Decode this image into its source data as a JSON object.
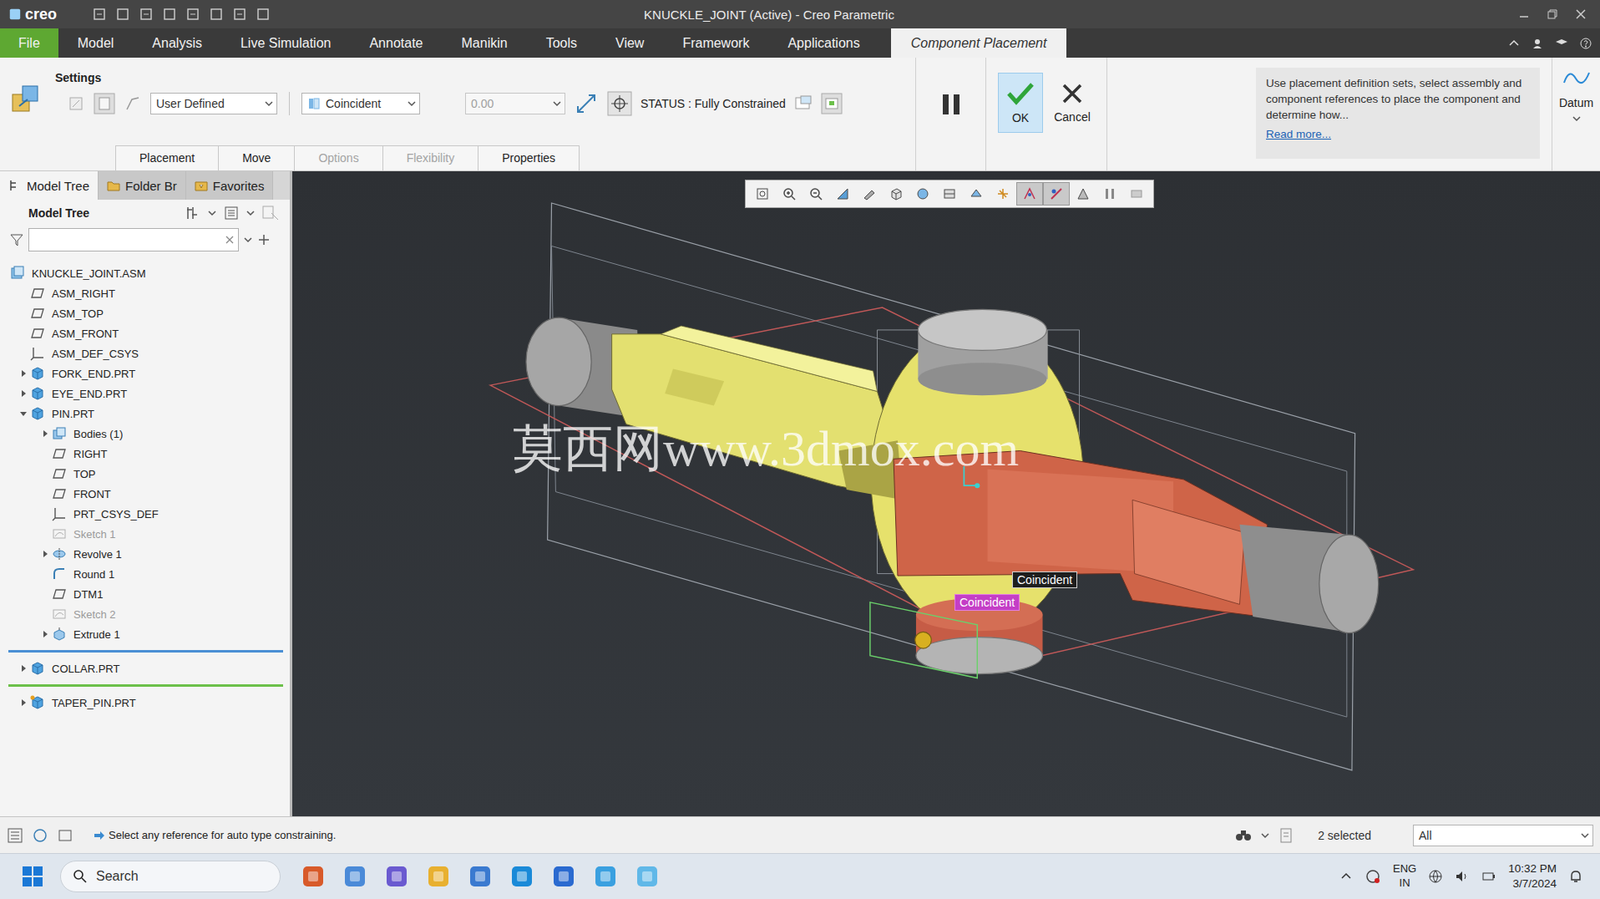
{
  "window": {
    "title": "KNUCKLE_JOINT (Active) - Creo Parametric",
    "logo": "creo"
  },
  "menu": [
    {
      "label": "File",
      "kind": "file",
      "selected": false
    },
    {
      "label": "Model",
      "kind": "tab",
      "selected": false
    },
    {
      "label": "Analysis",
      "kind": "tab",
      "selected": false
    },
    {
      "label": "Live Simulation",
      "kind": "tab",
      "selected": false
    },
    {
      "label": "Annotate",
      "kind": "tab",
      "selected": false
    },
    {
      "label": "Manikin",
      "kind": "tab",
      "selected": false
    },
    {
      "label": "Tools",
      "kind": "tab",
      "selected": false
    },
    {
      "label": "View",
      "kind": "tab",
      "selected": false
    },
    {
      "label": "Framework",
      "kind": "tab",
      "selected": false
    },
    {
      "label": "Applications",
      "kind": "tab",
      "selected": false
    },
    {
      "label": "Component Placement",
      "kind": "context",
      "selected": true
    }
  ],
  "ribbon": {
    "group_label": "Settings",
    "set_type": "User Defined",
    "constraint_type": "Coincident",
    "offset": {
      "value": "0.00",
      "disabled": true
    },
    "status": "STATUS : Fully Constrained",
    "ok": "OK",
    "cancel": "Cancel",
    "help": "Use placement definition sets, select assembly and component references to place the component and determine how...",
    "read_more": "Read more...",
    "datum": "Datum",
    "sub_tabs": [
      {
        "label": "Placement",
        "disabled": false,
        "selected": false
      },
      {
        "label": "Move",
        "disabled": false,
        "selected": false
      },
      {
        "label": "Options",
        "disabled": true,
        "selected": false
      },
      {
        "label": "Flexibility",
        "disabled": true,
        "selected": false
      },
      {
        "label": "Properties",
        "disabled": false,
        "selected": false
      }
    ]
  },
  "model_tree": {
    "tabs": [
      {
        "label": "Model Tree",
        "selected": true
      },
      {
        "label": "Folder Br",
        "selected": false
      },
      {
        "label": "Favorites",
        "selected": false
      }
    ],
    "title": "Model Tree",
    "items": [
      {
        "label": "KNUCKLE_JOINT.ASM",
        "level": 0,
        "kind": "assembly",
        "expander": "none",
        "greyed": false,
        "placing": false
      },
      {
        "label": "ASM_RIGHT",
        "level": 1,
        "kind": "plane",
        "expander": "none",
        "greyed": false,
        "placing": false
      },
      {
        "label": "ASM_TOP",
        "level": 1,
        "kind": "plane",
        "expander": "none",
        "greyed": false,
        "placing": false
      },
      {
        "label": "ASM_FRONT",
        "level": 1,
        "kind": "plane",
        "expander": "none",
        "greyed": false,
        "placing": false
      },
      {
        "label": "ASM_DEF_CSYS",
        "level": 1,
        "kind": "csys",
        "expander": "none",
        "greyed": false,
        "placing": false
      },
      {
        "label": "FORK_END.PRT",
        "level": 1,
        "kind": "part",
        "expander": "collapsed",
        "greyed": false,
        "placing": false
      },
      {
        "label": "EYE_END.PRT",
        "level": 1,
        "kind": "part",
        "expander": "collapsed",
        "greyed": false,
        "placing": false
      },
      {
        "label": "PIN.PRT",
        "level": 1,
        "kind": "part",
        "expander": "expanded",
        "greyed": false,
        "placing": false
      },
      {
        "label": "Bodies (1)",
        "level": 2,
        "kind": "bodies",
        "expander": "collapsed",
        "greyed": false,
        "placing": false
      },
      {
        "label": "RIGHT",
        "level": 2,
        "kind": "plane",
        "expander": "none",
        "greyed": false,
        "placing": false
      },
      {
        "label": "TOP",
        "level": 2,
        "kind": "plane",
        "expander": "none",
        "greyed": false,
        "placing": false
      },
      {
        "label": "FRONT",
        "level": 2,
        "kind": "plane",
        "expander": "none",
        "greyed": false,
        "placing": false
      },
      {
        "label": "PRT_CSYS_DEF",
        "level": 2,
        "kind": "csys",
        "expander": "none",
        "greyed": false,
        "placing": false
      },
      {
        "label": "Sketch 1",
        "level": 2,
        "kind": "sketch",
        "expander": "none",
        "greyed": true,
        "placing": false
      },
      {
        "label": "Revolve 1",
        "level": 2,
        "kind": "revolve",
        "expander": "collapsed",
        "greyed": false,
        "placing": false
      },
      {
        "label": "Round 1",
        "level": 2,
        "kind": "round",
        "expander": "none",
        "greyed": false,
        "placing": false
      },
      {
        "label": "DTM1",
        "level": 2,
        "kind": "plane",
        "expander": "none",
        "greyed": false,
        "placing": false
      },
      {
        "label": "Sketch 2",
        "level": 2,
        "kind": "sketch",
        "expander": "none",
        "greyed": true,
        "placing": false
      },
      {
        "label": "Extrude 1",
        "level": 2,
        "kind": "extrude",
        "expander": "collapsed",
        "greyed": false,
        "placing": false
      },
      {
        "label": "",
        "level": 0,
        "kind": "divider",
        "expander": "none",
        "greyed": false,
        "placing": false,
        "color": "#4a8fd4"
      },
      {
        "label": "COLLAR.PRT",
        "level": 1,
        "kind": "part",
        "expander": "collapsed",
        "greyed": false,
        "placing": false
      },
      {
        "label": "",
        "level": 0,
        "kind": "divider",
        "expander": "none",
        "greyed": false,
        "placing": false,
        "color": "#6cc04a"
      },
      {
        "label": "TAPER_PIN.PRT",
        "level": 1,
        "kind": "part",
        "expander": "collapsed",
        "greyed": false,
        "placing": true
      }
    ]
  },
  "viewport": {
    "watermark": "莫西网www.3dmox.com",
    "labels": [
      {
        "text": "Coincident",
        "selected": false
      },
      {
        "text": "Coincident",
        "selected": true
      }
    ],
    "toolbar": [
      {
        "selected": false
      },
      {
        "selected": false
      },
      {
        "selected": false
      },
      {
        "selected": false
      },
      {
        "selected": false
      },
      {
        "selected": false
      },
      {
        "selected": false
      },
      {
        "selected": false
      },
      {
        "selected": false
      },
      {
        "selected": false
      },
      {
        "selected": true
      },
      {
        "selected": true
      },
      {
        "selected": false
      },
      {
        "selected": false
      },
      {
        "selected": false
      }
    ]
  },
  "status_bar": {
    "message": "Select any reference for auto type constraining.",
    "selection": "2 selected",
    "filter": "All"
  },
  "taskbar": {
    "search": "Search",
    "language": "ENG",
    "region": "IN",
    "time": "10:32 PM",
    "date": "3/7/2024"
  }
}
